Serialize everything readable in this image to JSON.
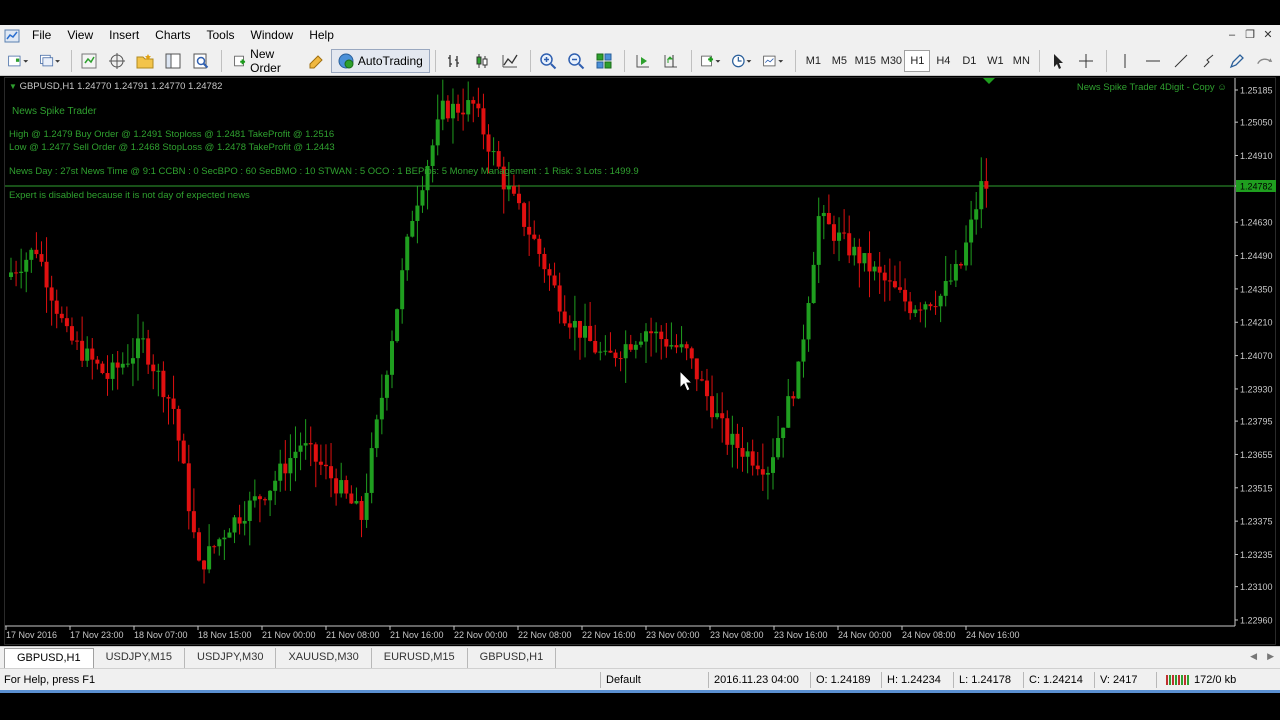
{
  "menu": {
    "items": [
      "File",
      "View",
      "Insert",
      "Charts",
      "Tools",
      "Window",
      "Help"
    ]
  },
  "toolbar": {
    "new_order_label": "New Order",
    "autotrading_label": "AutoTrading",
    "timeframes": [
      "M1",
      "M5",
      "M15",
      "M30",
      "H1",
      "H4",
      "D1",
      "W1",
      "MN"
    ],
    "active_timeframe": "H1"
  },
  "chart": {
    "header": "GBPUSD,H1  1.24770 1.24791 1.24770 1.24782",
    "expert_name": "News Spike Trader 4Digit - Copy",
    "ea_title": "News Spike Trader",
    "high_line": "High @ 1.2479 Buy Order @ 1.2491 Stoploss @ 1.2481 TakeProfit @ 1.2516",
    "low_line": "Low @ 1.2477 Sell Order @ 1.2468 StopLoss @ 1.2478 TakeProfit @ 1.2443",
    "news_line": "News Day : 27st News Time @ 9:1 CCBN : 0 SecBPO : 60 SecBMO : 10 STWAN : 5 OCO : 1 BEPips: 5 Money Management : 1 Risk: 3 Lots : 1499.9",
    "expert_line": "Expert is disabled because it is not day of expected news",
    "current_price": "1.24782",
    "price_axis": [
      "1.25185",
      "1.25050",
      "1.24910",
      "1.24782",
      "1.24630",
      "1.24490",
      "1.24350",
      "1.24210",
      "1.24070",
      "1.23930",
      "1.23795",
      "1.23655",
      "1.23515",
      "1.23375",
      "1.23235",
      "1.23100",
      "1.22960"
    ],
    "time_axis": [
      "17 Nov 2016",
      "17 Nov 23:00",
      "18 Nov 07:00",
      "18 Nov 15:00",
      "21 Nov 00:00",
      "21 Nov 08:00",
      "21 Nov 16:00",
      "22 Nov 00:00",
      "22 Nov 08:00",
      "22 Nov 16:00",
      "23 Nov 00:00",
      "23 Nov 08:00",
      "23 Nov 16:00",
      "24 Nov 00:00",
      "24 Nov 08:00",
      "24 Nov 16:00"
    ],
    "colors": {
      "bull": "#1f9e1f",
      "bear": "#e01010",
      "text": "#2fa02f",
      "axis": "#c8c8c8"
    }
  },
  "tabs": [
    "GBPUSD,H1",
    "USDJPY,M15",
    "USDJPY,M30",
    "XAUUSD,M30",
    "EURUSD,M15",
    "GBPUSD,H1"
  ],
  "status": {
    "help": "For Help, press F1",
    "profile": "Default",
    "datetime": "2016.11.23 04:00",
    "open": "O: 1.24189",
    "high": "H: 1.24234",
    "low": "L: 1.24178",
    "close": "C: 1.24214",
    "volume": "V: 2417",
    "traffic": "172/0 kb"
  }
}
